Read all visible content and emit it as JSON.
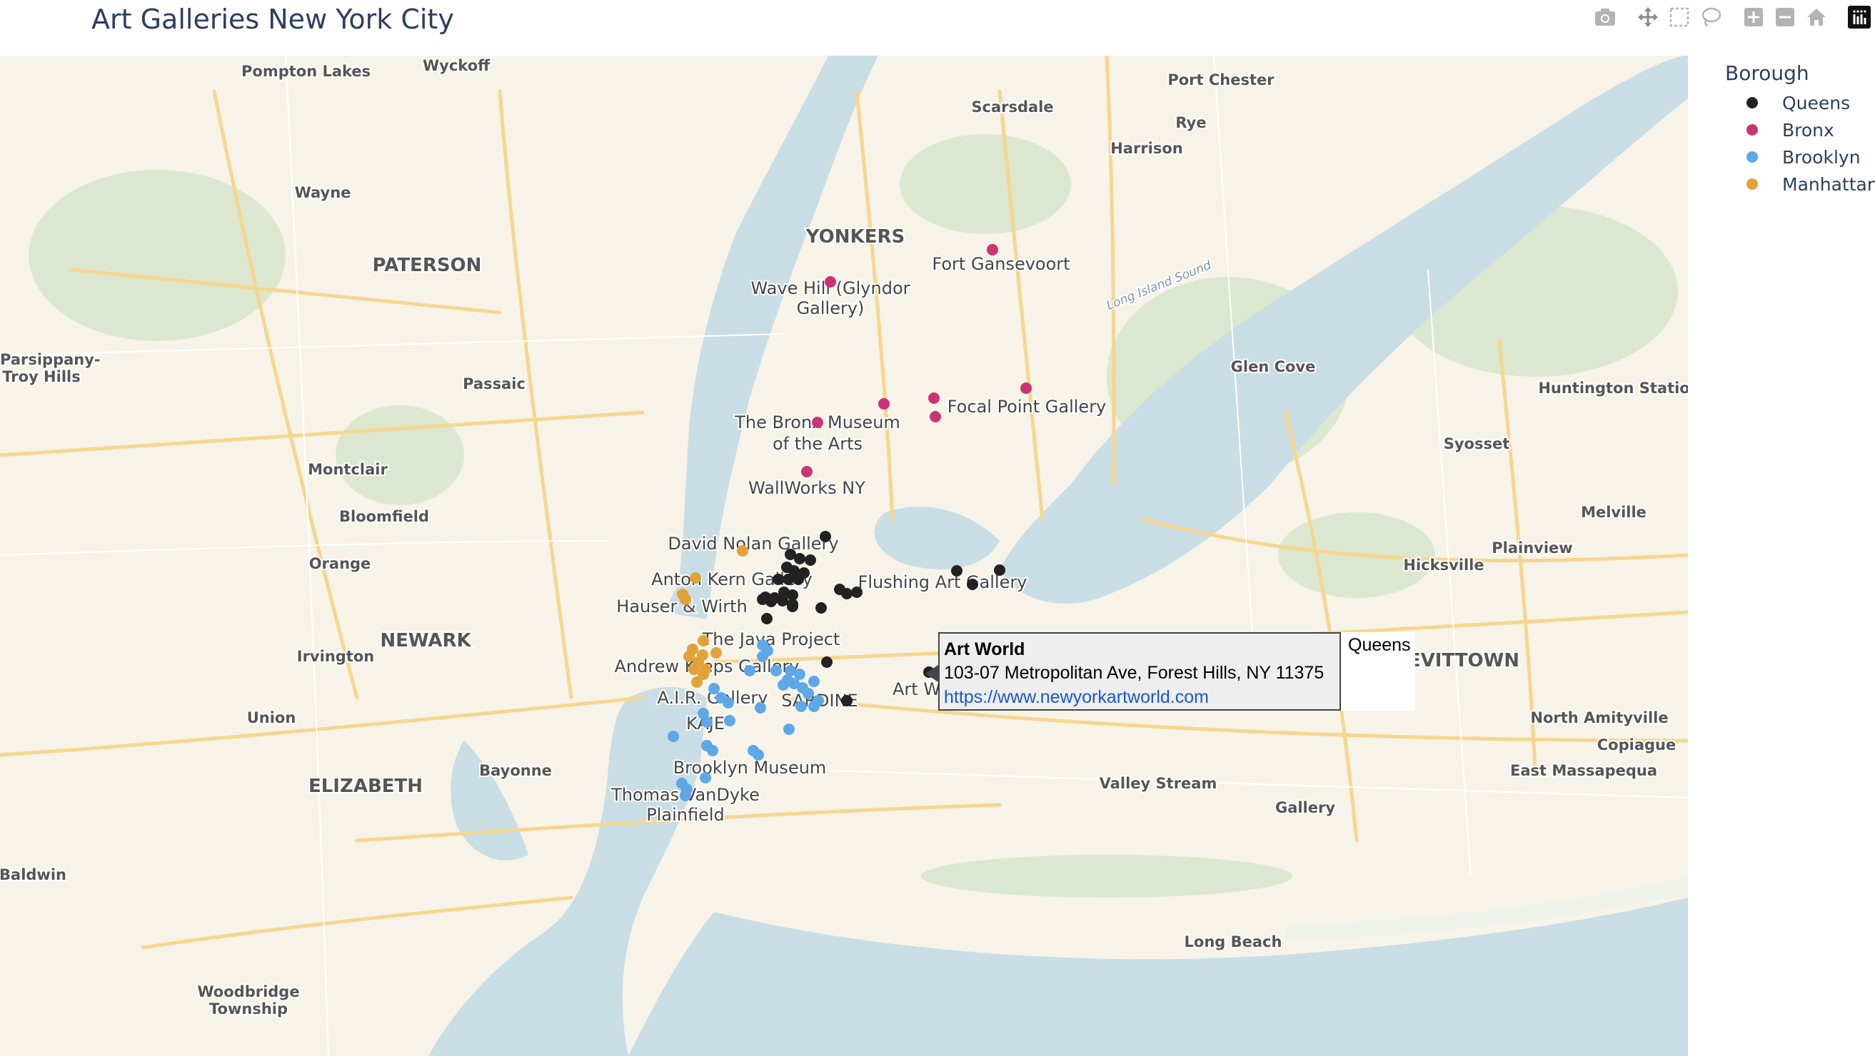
{
  "title": "Art Galleries New York City",
  "modebar": {
    "icons": [
      "camera-icon",
      "pan-icon",
      "box-select-icon",
      "lasso-icon",
      "zoom-in-icon",
      "zoom-out-icon",
      "home-icon",
      "plotly-logo-icon"
    ]
  },
  "legend": {
    "title": "Borough",
    "items": [
      {
        "label": "Queens",
        "color": "#222222"
      },
      {
        "label": "Bronx",
        "color": "#cc3377"
      },
      {
        "label": "Brooklyn",
        "color": "#5fa8e8"
      },
      {
        "label": "Manhattan",
        "color": "#e2a23a"
      }
    ]
  },
  "hover": {
    "name": "Art World",
    "address": "103-07 Metropolitan Ave, Forest Hills, NY 11375",
    "url": "https://www.newyorkartworld.com",
    "borough": "Queens"
  },
  "colors": {
    "land": "#f7f3e8",
    "water": "#c9dde5",
    "park": "#dbe8cf",
    "highway": "#f6d68f",
    "queens": "#222222",
    "bronx": "#cc3377",
    "brooklyn": "#5fa8e8",
    "manhattan": "#e2a23a"
  },
  "place_labels": [
    "Pompton Lakes",
    "Wyckoff",
    "Port Chester",
    "Scarsdale",
    "Rye",
    "Harrison",
    "Wayne",
    "YONKERS",
    "PATERSON",
    "Fort Gansevoort",
    "Parsippany-",
    "Troy Hills",
    "Wave Hill (Glyndor",
    "Gallery)",
    "Long Island Sound",
    "Glen Cove",
    "Passaic",
    "Focal Point Gallery",
    "Huntington Station",
    "The Bronx Museum",
    "of the Arts",
    "Syosset",
    "Montclair",
    "WallWorks NY",
    "Melville",
    "Bloomfield",
    "David Nolan Gallery",
    "Plainview",
    "Orange",
    "Anton Kern Gallery",
    "Flushing Art Gallery",
    "Hicksville",
    "Hauser & Wirth",
    "NEWARK",
    "The Java Project",
    "Irvington",
    "Andrew Kreps Gallery",
    "EVITTOWN",
    "Art W",
    "A.I.R. Gallery",
    "SARDINE",
    "Union",
    "KAJE",
    "North Amityville",
    "Copiague",
    "Bayonne",
    "Brooklyn Museum",
    "East Massapequa",
    "ELIZABETH",
    "Valley Stream",
    "Thomas VanDyke",
    "Gallery",
    "Baldwin",
    "Plainfield",
    "Long Beach",
    "Woodbridge",
    "Township"
  ],
  "points": {
    "queens": [
      [
        1156,
        752
      ],
      [
        1107,
        777
      ],
      [
        1120,
        783
      ],
      [
        1135,
        785
      ],
      [
        1102,
        795
      ],
      [
        1112,
        800
      ],
      [
        1126,
        803
      ],
      [
        1090,
        812
      ],
      [
        1104,
        812
      ],
      [
        1118,
        812
      ],
      [
        1098,
        830
      ],
      [
        1110,
        834
      ],
      [
        1072,
        837
      ],
      [
        1085,
        838
      ],
      [
        1096,
        842
      ],
      [
        1110,
        847
      ],
      [
        1080,
        843
      ],
      [
        1068,
        840
      ],
      [
        1176,
        826
      ],
      [
        1186,
        832
      ],
      [
        1200,
        830
      ],
      [
        1110,
        850
      ],
      [
        1150,
        852
      ],
      [
        1074,
        867
      ],
      [
        1340,
        800
      ],
      [
        1362,
        819
      ],
      [
        1400,
        799
      ],
      [
        1158,
        928
      ],
      [
        1186,
        982
      ],
      [
        1301,
        942
      ]
    ],
    "bronx": [
      [
        1163,
        395
      ],
      [
        1238,
        566
      ],
      [
        1308,
        558
      ],
      [
        1310,
        584
      ],
      [
        1145,
        592
      ],
      [
        1130,
        661
      ],
      [
        1390,
        350
      ],
      [
        1437,
        544
      ]
    ],
    "brooklyn": [
      [
        1068,
        904
      ],
      [
        1075,
        912
      ],
      [
        1068,
        920
      ],
      [
        1050,
        940
      ],
      [
        1087,
        940
      ],
      [
        1107,
        940
      ],
      [
        1120,
        945
      ],
      [
        1103,
        953
      ],
      [
        1112,
        958
      ],
      [
        1124,
        964
      ],
      [
        1097,
        960
      ],
      [
        1140,
        955
      ],
      [
        1000,
        965
      ],
      [
        1010,
        978
      ],
      [
        1020,
        985
      ],
      [
        1132,
        972
      ],
      [
        1146,
        982
      ],
      [
        1122,
        990
      ],
      [
        1140,
        990
      ],
      [
        1065,
        992
      ],
      [
        985,
        1000
      ],
      [
        990,
        1012
      ],
      [
        1022,
        1010
      ],
      [
        1105,
        1022
      ],
      [
        943,
        1032
      ],
      [
        990,
        1045
      ],
      [
        998,
        1052
      ],
      [
        1055,
        1052
      ],
      [
        1062,
        1058
      ],
      [
        988,
        1090
      ],
      [
        955,
        1098
      ],
      [
        962,
        1106
      ],
      [
        960,
        1115
      ]
    ],
    "manhattan": [
      [
        1040,
        772
      ],
      [
        974,
        810
      ],
      [
        956,
        833
      ],
      [
        960,
        840
      ],
      [
        985,
        898
      ],
      [
        970,
        910
      ],
      [
        984,
        918
      ],
      [
        1003,
        915
      ],
      [
        965,
        920
      ],
      [
        978,
        928
      ],
      [
        972,
        938
      ],
      [
        988,
        938
      ],
      [
        985,
        945
      ],
      [
        976,
        956
      ]
    ]
  }
}
